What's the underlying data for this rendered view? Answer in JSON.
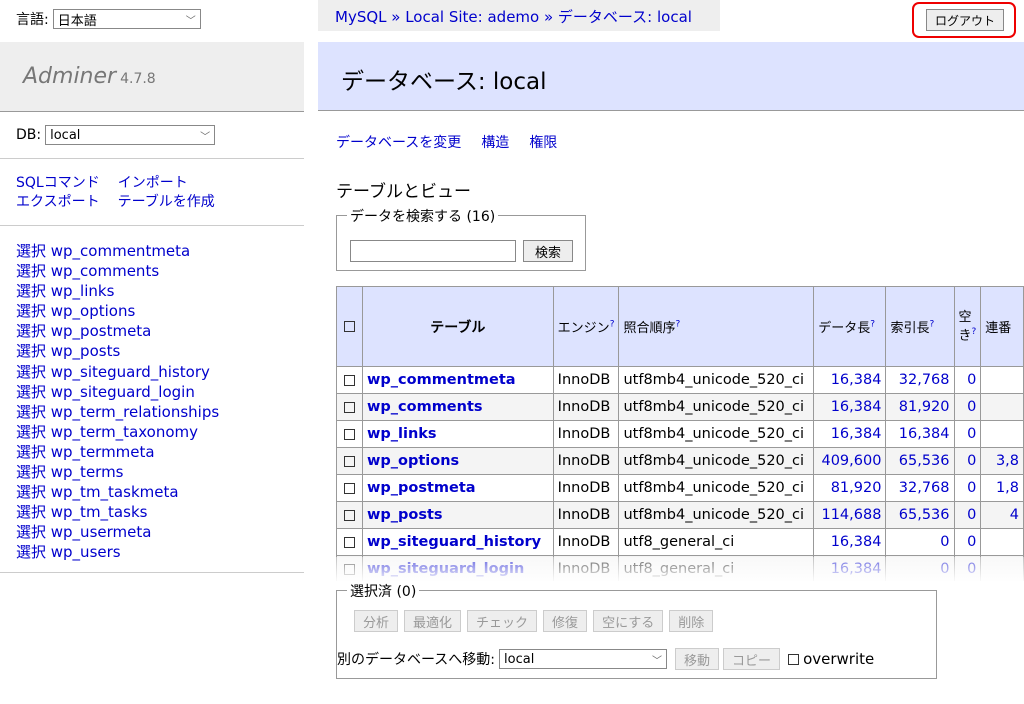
{
  "lang": {
    "label": "言語:",
    "value": "日本語"
  },
  "brand": {
    "name": "Adminer",
    "version": "4.7.8"
  },
  "db": {
    "label": "DB:",
    "value": "local"
  },
  "commands": [
    "SQLコマンド",
    "インポート",
    "エクスポート",
    "テーブルを作成"
  ],
  "sidebar_tables": [
    "選択 wp_commentmeta",
    "選択 wp_comments",
    "選択 wp_links",
    "選択 wp_options",
    "選択 wp_postmeta",
    "選択 wp_posts",
    "選択 wp_siteguard_history",
    "選択 wp_siteguard_login",
    "選択 wp_term_relationships",
    "選択 wp_term_taxonomy",
    "選択 wp_termmeta",
    "選択 wp_terms",
    "選択 wp_tm_taskmeta",
    "選択 wp_tm_tasks",
    "選択 wp_usermeta",
    "選択 wp_users"
  ],
  "breadcrumb": "MySQL » Local Site: ademo » データベース: local",
  "logout": "ログアウト",
  "page_title": "データベース: local",
  "links": [
    "データベースを変更",
    "構造",
    "権限"
  ],
  "section_title": "テーブルとビュー",
  "search": {
    "legend": "データを検索する (16)",
    "button": "検索"
  },
  "table_headers": {
    "table": "テーブル",
    "engine": "エンジン",
    "collation": "照合順序",
    "data_length": "データ長",
    "index_length": "索引長",
    "free": "空き",
    "auto": "連番"
  },
  "rows": [
    {
      "name": "wp_commentmeta",
      "engine": "InnoDB",
      "collation": "utf8mb4_unicode_520_ci",
      "data": "16,384",
      "index": "32,768",
      "free": "0",
      "extra": ""
    },
    {
      "name": "wp_comments",
      "engine": "InnoDB",
      "collation": "utf8mb4_unicode_520_ci",
      "data": "16,384",
      "index": "81,920",
      "free": "0",
      "extra": ""
    },
    {
      "name": "wp_links",
      "engine": "InnoDB",
      "collation": "utf8mb4_unicode_520_ci",
      "data": "16,384",
      "index": "16,384",
      "free": "0",
      "extra": ""
    },
    {
      "name": "wp_options",
      "engine": "InnoDB",
      "collation": "utf8mb4_unicode_520_ci",
      "data": "409,600",
      "index": "65,536",
      "free": "0",
      "extra": "3,8"
    },
    {
      "name": "wp_postmeta",
      "engine": "InnoDB",
      "collation": "utf8mb4_unicode_520_ci",
      "data": "81,920",
      "index": "32,768",
      "free": "0",
      "extra": "1,8"
    },
    {
      "name": "wp_posts",
      "engine": "InnoDB",
      "collation": "utf8mb4_unicode_520_ci",
      "data": "114,688",
      "index": "65,536",
      "free": "0",
      "extra": "4"
    },
    {
      "name": "wp_siteguard_history",
      "engine": "InnoDB",
      "collation": "utf8_general_ci",
      "data": "16,384",
      "index": "0",
      "free": "0",
      "extra": ""
    },
    {
      "name": "wp_siteguard_login",
      "engine": "InnoDB",
      "collation": "utf8_general_ci",
      "data": "16,384",
      "index": "0",
      "free": "0",
      "extra": ""
    }
  ],
  "selection": {
    "legend": "選択済 (0)",
    "buttons": [
      "分析",
      "最適化",
      "チェック",
      "修復",
      "空にする",
      "削除"
    ],
    "move_label": "別のデータベースへ移動:",
    "move_value": "local",
    "move_button": "移動",
    "copy_button": "コピー",
    "overwrite": "overwrite"
  }
}
